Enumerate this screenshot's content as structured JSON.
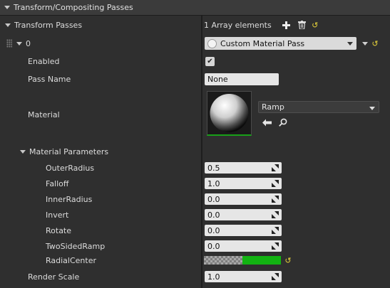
{
  "header": {
    "title": "Transform/Compositing Passes"
  },
  "transform_passes": {
    "label": "Transform Passes",
    "count_label": "1 Array elements"
  },
  "element": {
    "index": "0",
    "type_selected": "Custom Material Pass"
  },
  "enabled": {
    "label": "Enabled",
    "checked": true,
    "check_glyph": "✔"
  },
  "pass_name": {
    "label": "Pass Name",
    "value": "None"
  },
  "material": {
    "label": "Material",
    "asset": "Ramp"
  },
  "material_parameters": {
    "label": "Material Parameters",
    "params": [
      {
        "label": "OuterRadius",
        "value": "0.5"
      },
      {
        "label": "Falloff",
        "value": "1.0"
      },
      {
        "label": "InnerRadius",
        "value": "0.0"
      },
      {
        "label": "Invert",
        "value": "0.0"
      },
      {
        "label": "Rotate",
        "value": "0.0"
      },
      {
        "label": "TwoSidedRamp",
        "value": "0.0"
      }
    ],
    "radial_center": {
      "label": "RadialCenter",
      "color": "#12b312"
    }
  },
  "render_scale": {
    "label": "Render Scale",
    "value": "1.0"
  },
  "colors": {
    "reset_arrow": "#e8d43a",
    "thumbnail_underline": "#18a018"
  }
}
